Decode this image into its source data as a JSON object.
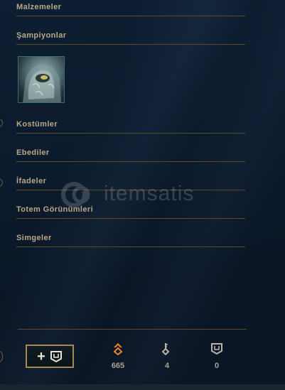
{
  "sections": [
    {
      "label": "Malzemeler"
    },
    {
      "label": "Şampiyonlar"
    },
    {
      "label": "Kostümler"
    },
    {
      "label": "Ebediler"
    },
    {
      "label": "İfadeler"
    },
    {
      "label": "Totem Görünümleri"
    },
    {
      "label": "Simgeler"
    }
  ],
  "watermark": {
    "text": "itemsatis"
  },
  "wallet": {
    "orange_essence": {
      "icon": "orange-essence-icon",
      "value": "665",
      "color": "#e8842a"
    },
    "keys": {
      "icon": "key-icon",
      "value": "4"
    },
    "chests": {
      "icon": "chest-icon",
      "value": "0"
    }
  },
  "colors": {
    "accent_gold": "#c8aa6e",
    "divider": "#5b4c29",
    "background": "#0b1a2c"
  }
}
